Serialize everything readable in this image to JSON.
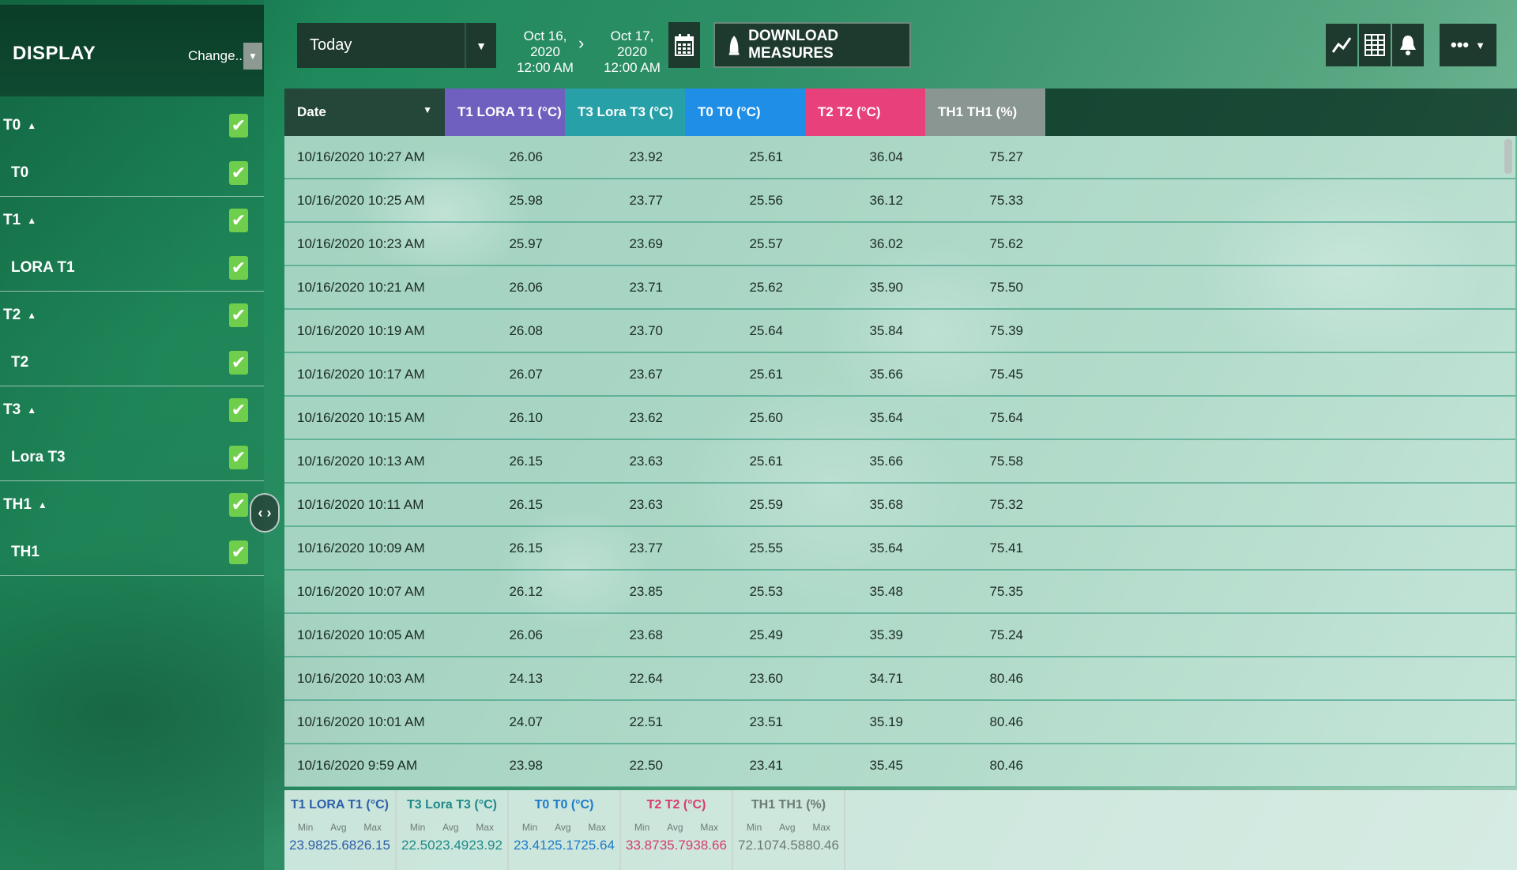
{
  "sidebar": {
    "title": "DISPLAY",
    "change_label": "Change...",
    "caret": "▼",
    "groups": [
      {
        "label": "T0",
        "child": "T0"
      },
      {
        "label": "T1",
        "child": "LORA T1"
      },
      {
        "label": "T2",
        "child": "T2"
      },
      {
        "label": "T3",
        "child": "Lora T3"
      },
      {
        "label": "TH1",
        "child": "TH1"
      }
    ],
    "check_glyph": "✔",
    "up_arrow": "▲",
    "collapse_glyph": "‹ ›"
  },
  "topbar": {
    "period": "Today",
    "caret": "▼",
    "from_date": "Oct 16, 2020",
    "from_time": "12:00 AM",
    "to_date": "Oct 17, 2020",
    "to_time": "12:00 AM",
    "separator": "›",
    "download_label": "DOWNLOAD MEASURES",
    "more_glyph": "•••",
    "more_caret": "▼"
  },
  "table": {
    "headers": [
      "Date",
      "T1 LORA T1 (°C)",
      "T3 Lora T3 (°C)",
      "T0 T0 (°C)",
      "T2 T2 (°C)",
      "TH1 TH1 (%)"
    ],
    "sort_caret": "▼",
    "rows": [
      [
        "10/16/2020 10:27 AM",
        "26.06",
        "23.92",
        "25.61",
        "36.04",
        "75.27"
      ],
      [
        "10/16/2020 10:25 AM",
        "25.98",
        "23.77",
        "25.56",
        "36.12",
        "75.33"
      ],
      [
        "10/16/2020 10:23 AM",
        "25.97",
        "23.69",
        "25.57",
        "36.02",
        "75.62"
      ],
      [
        "10/16/2020 10:21 AM",
        "26.06",
        "23.71",
        "25.62",
        "35.90",
        "75.50"
      ],
      [
        "10/16/2020 10:19 AM",
        "26.08",
        "23.70",
        "25.64",
        "35.84",
        "75.39"
      ],
      [
        "10/16/2020 10:17 AM",
        "26.07",
        "23.67",
        "25.61",
        "35.66",
        "75.45"
      ],
      [
        "10/16/2020 10:15 AM",
        "26.10",
        "23.62",
        "25.60",
        "35.64",
        "75.64"
      ],
      [
        "10/16/2020 10:13 AM",
        "26.15",
        "23.63",
        "25.61",
        "35.66",
        "75.58"
      ],
      [
        "10/16/2020 10:11 AM",
        "26.15",
        "23.63",
        "25.59",
        "35.68",
        "75.32"
      ],
      [
        "10/16/2020 10:09 AM",
        "26.15",
        "23.77",
        "25.55",
        "35.64",
        "75.41"
      ],
      [
        "10/16/2020 10:07 AM",
        "26.12",
        "23.85",
        "25.53",
        "35.48",
        "75.35"
      ],
      [
        "10/16/2020 10:05 AM",
        "26.06",
        "23.68",
        "25.49",
        "35.39",
        "75.24"
      ],
      [
        "10/16/2020 10:03 AM",
        "24.13",
        "22.64",
        "23.60",
        "34.71",
        "80.46"
      ],
      [
        "10/16/2020 10:01 AM",
        "24.07",
        "22.51",
        "23.51",
        "35.19",
        "80.46"
      ],
      [
        "10/16/2020 9:59 AM",
        "23.98",
        "22.50",
        "23.41",
        "35.45",
        "80.46"
      ]
    ]
  },
  "summary": [
    {
      "title": "T1 LORA T1 (°C)",
      "color": "#2f5fa8",
      "min": "23.98",
      "avg": "25.68",
      "max": "26.15"
    },
    {
      "title": "T3 Lora T3 (°C)",
      "color": "#1f8a8a",
      "min": "22.50",
      "avg": "23.49",
      "max": "23.92"
    },
    {
      "title": "T0 T0 (°C)",
      "color": "#1e7ac8",
      "min": "23.41",
      "avg": "25.17",
      "max": "25.64"
    },
    {
      "title": "T2 T2 (°C)",
      "color": "#d83a6e",
      "min": "33.87",
      "avg": "35.79",
      "max": "38.66"
    },
    {
      "title": "TH1 TH1 (%)",
      "color": "#6c7b75",
      "min": "72.10",
      "avg": "74.58",
      "max": "80.46"
    }
  ],
  "summary_labels": {
    "min": "Min",
    "avg": "Avg",
    "max": "Max"
  }
}
